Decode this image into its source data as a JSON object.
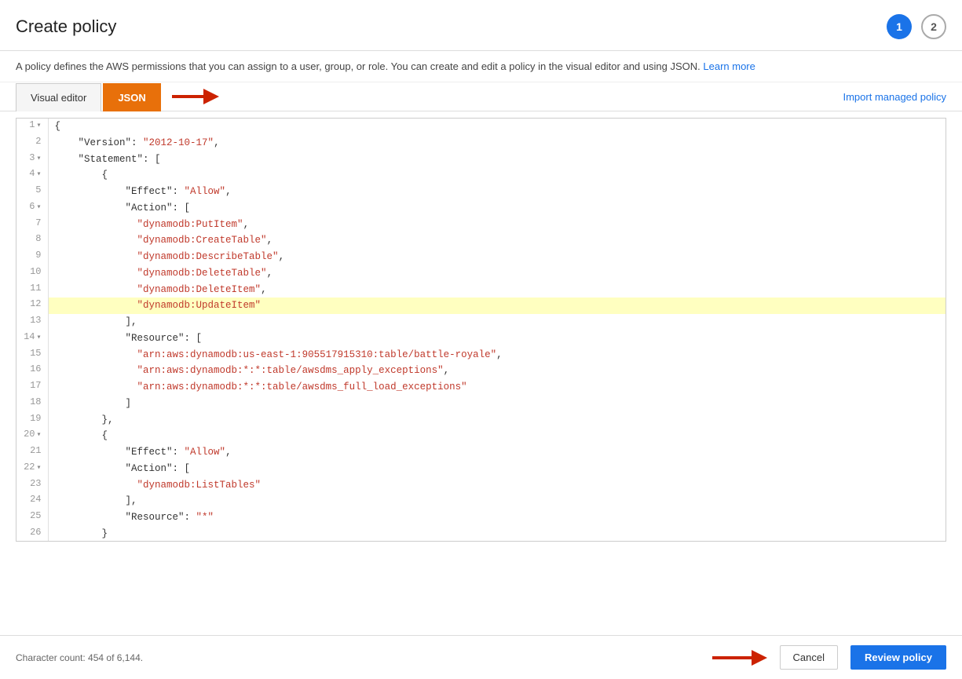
{
  "header": {
    "title": "Create policy",
    "step1": "1",
    "step2": "2"
  },
  "description": {
    "text": "A policy defines the AWS permissions that you can assign to a user, group, or role. You can create and edit a policy in the visual editor and using JSON.",
    "link_text": "Learn more"
  },
  "tabs": {
    "visual_editor": "Visual editor",
    "json": "JSON",
    "import_link": "Import managed policy"
  },
  "code_lines": [
    {
      "num": "1",
      "collapsible": true,
      "highlighted": false,
      "content": "{"
    },
    {
      "num": "2",
      "collapsible": false,
      "highlighted": false,
      "content": "    \"Version\": \"2012-10-17\","
    },
    {
      "num": "3",
      "collapsible": true,
      "highlighted": false,
      "content": "    \"Statement\": ["
    },
    {
      "num": "4",
      "collapsible": true,
      "highlighted": false,
      "content": "        {"
    },
    {
      "num": "5",
      "collapsible": false,
      "highlighted": false,
      "content": "            \"Effect\": \"Allow\","
    },
    {
      "num": "6",
      "collapsible": true,
      "highlighted": false,
      "content": "            \"Action\": ["
    },
    {
      "num": "7",
      "collapsible": false,
      "highlighted": false,
      "content": "              \"dynamodb:PutItem\","
    },
    {
      "num": "8",
      "collapsible": false,
      "highlighted": false,
      "content": "              \"dynamodb:CreateTable\","
    },
    {
      "num": "9",
      "collapsible": false,
      "highlighted": false,
      "content": "              \"dynamodb:DescribeTable\","
    },
    {
      "num": "10",
      "collapsible": false,
      "highlighted": false,
      "content": "              \"dynamodb:DeleteTable\","
    },
    {
      "num": "11",
      "collapsible": false,
      "highlighted": false,
      "content": "              \"dynamodb:DeleteItem\","
    },
    {
      "num": "12",
      "collapsible": false,
      "highlighted": true,
      "content": "              \"dynamodb:UpdateItem\""
    },
    {
      "num": "13",
      "collapsible": false,
      "highlighted": false,
      "content": "            ],"
    },
    {
      "num": "14",
      "collapsible": true,
      "highlighted": false,
      "content": "            \"Resource\": ["
    },
    {
      "num": "15",
      "collapsible": false,
      "highlighted": false,
      "content": "              \"arn:aws:dynamodb:us-east-1:905517915310:table/battle-royale\","
    },
    {
      "num": "16",
      "collapsible": false,
      "highlighted": false,
      "content": "              \"arn:aws:dynamodb:*:*:table/awsdms_apply_exceptions\","
    },
    {
      "num": "17",
      "collapsible": false,
      "highlighted": false,
      "content": "              \"arn:aws:dynamodb:*:*:table/awsdms_full_load_exceptions\""
    },
    {
      "num": "18",
      "collapsible": false,
      "highlighted": false,
      "content": "            ]"
    },
    {
      "num": "19",
      "collapsible": false,
      "highlighted": false,
      "content": "        },"
    },
    {
      "num": "20",
      "collapsible": true,
      "highlighted": false,
      "content": "        {"
    },
    {
      "num": "21",
      "collapsible": false,
      "highlighted": false,
      "content": "            \"Effect\": \"Allow\","
    },
    {
      "num": "22",
      "collapsible": true,
      "highlighted": false,
      "content": "            \"Action\": ["
    },
    {
      "num": "23",
      "collapsible": false,
      "highlighted": false,
      "content": "              \"dynamodb:ListTables\""
    },
    {
      "num": "24",
      "collapsible": false,
      "highlighted": false,
      "content": "            ],"
    },
    {
      "num": "25",
      "collapsible": false,
      "highlighted": false,
      "content": "            \"Resource\": \"*\""
    },
    {
      "num": "26",
      "collapsible": false,
      "highlighted": false,
      "content": "        }"
    }
  ],
  "footer": {
    "char_count": "Character count: 454 of 6,144.",
    "cancel_label": "Cancel",
    "review_label": "Review policy"
  }
}
